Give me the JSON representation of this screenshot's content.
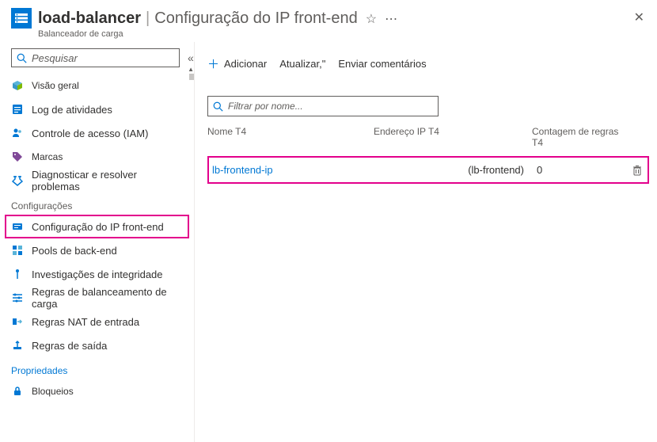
{
  "header": {
    "title": "load-balancer",
    "section": "Configuração do IP front-end",
    "subtext": "Balanceador de carga"
  },
  "sidebar": {
    "search_placeholder": "Pesquisar",
    "items_top": [
      {
        "label": "Visão geral",
        "icon": "overview"
      },
      {
        "label": "Log de atividades",
        "icon": "activity"
      },
      {
        "label": "Controle de acesso (IAM)",
        "icon": "access"
      },
      {
        "label": "Marcas",
        "icon": "tags"
      },
      {
        "label": "Diagnosticar e resolver problemas",
        "icon": "diagnose"
      }
    ],
    "section_config": "Configurações",
    "items_config": [
      {
        "label": "Configuração do IP front-end",
        "icon": "frontend",
        "highlight": true
      },
      {
        "label": "Pools de back-end",
        "icon": "backend"
      },
      {
        "label": "Investigações de integridade",
        "icon": "probe"
      },
      {
        "label": "Regras de balanceamento de carga",
        "icon": "lbrules"
      },
      {
        "label": "Regras NAT de entrada",
        "icon": "nat"
      },
      {
        "label": "Regras de saída",
        "icon": "outbound"
      }
    ],
    "section_props": "Propriedades",
    "items_props": [
      {
        "label": "Bloqueios",
        "icon": "locks"
      }
    ]
  },
  "toolbar": {
    "add": "Adicionar",
    "refresh": "Atualizar,\"",
    "feedback": "Enviar comentários"
  },
  "main": {
    "filter_placeholder": "Filtrar por nome...",
    "columns": {
      "name": "Nome T4",
      "ip": "Endereço IP T4",
      "rules": "Contagem de regras T4"
    },
    "rows": [
      {
        "name": "lb-frontend-ip",
        "ip": "(lb-frontend)",
        "rules": "0"
      }
    ]
  }
}
